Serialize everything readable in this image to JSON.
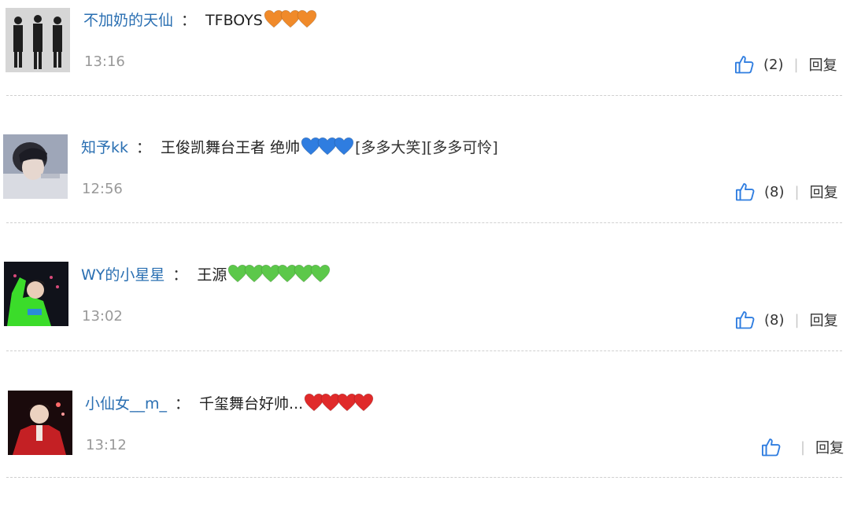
{
  "comments": [
    {
      "username": "不加奶的天仙",
      "text": "TFBOYS",
      "hearts": [
        "#f08a2a",
        "#f08a2a",
        "#f08a2a"
      ],
      "stickers": "",
      "time": "13:16",
      "like_count": "(2)",
      "reply_label": "回复"
    },
    {
      "username": "知予kk",
      "text": "王俊凯舞台王者 绝帅",
      "hearts": [
        "#2f7de0",
        "#2f7de0",
        "#2f7de0"
      ],
      "stickers": "[多多大笑][多多可怜]",
      "time": "12:56",
      "like_count": "(8)",
      "reply_label": "回复"
    },
    {
      "username": "WY的小星星",
      "text": "王源",
      "hearts": [
        "#5cc84a",
        "#5cc84a",
        "#5cc84a",
        "#5cc84a",
        "#5cc84a",
        "#5cc84a"
      ],
      "stickers": "",
      "time": "13:02",
      "like_count": "(8)",
      "reply_label": "回复"
    },
    {
      "username": "小仙女__m_",
      "text": "千玺舞台好帅...",
      "hearts": [
        "#e02a2a",
        "#e02a2a",
        "#e02a2a",
        "#e02a2a"
      ],
      "stickers": "",
      "time": "13:12",
      "like_count": "",
      "reply_label": "回复"
    }
  ],
  "colon": "："
}
